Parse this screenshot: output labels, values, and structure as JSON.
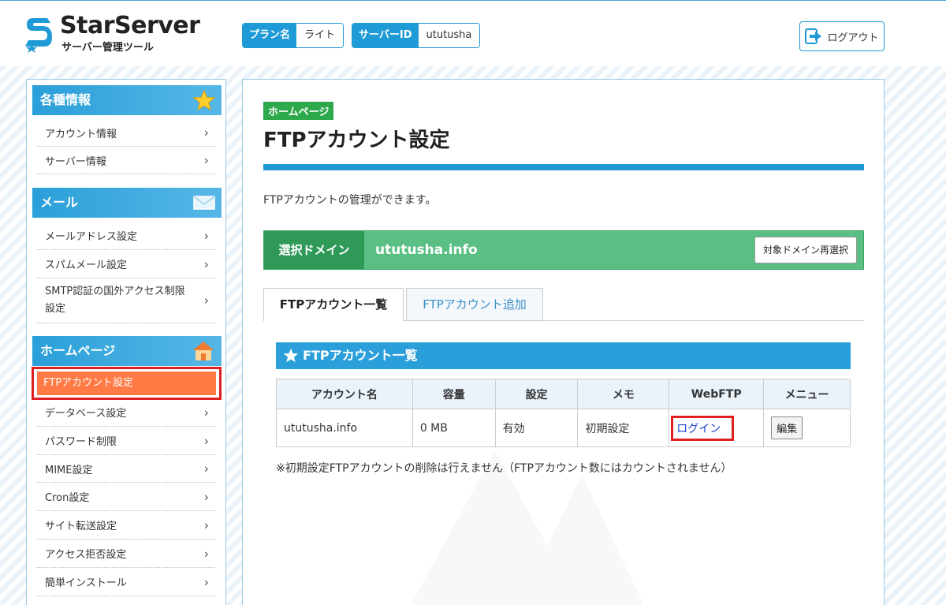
{
  "header": {
    "logo_title": "StarServer",
    "logo_subtitle": "サーバー管理ツール",
    "plan_label": "プラン名",
    "plan_value": "ライト",
    "server_id_label": "サーバーID",
    "server_id_value": "ututusha",
    "logout_label": "ログアウト"
  },
  "sidebar": {
    "sections": [
      {
        "title": "各種情報",
        "icon": "star-icon",
        "items": [
          "アカウント情報",
          "サーバー情報"
        ]
      },
      {
        "title": "メール",
        "icon": "mail-icon",
        "items": [
          "メールアドレス設定",
          "スパムメール設定",
          "SMTP認証の国外アクセス制限設定"
        ]
      },
      {
        "title": "ホームページ",
        "icon": "house-icon",
        "items": [
          "FTPアカウント設定",
          "データベース設定",
          "パスワード制限",
          "MIME設定",
          "Cron設定",
          "サイト転送設定",
          "アクセス拒否設定",
          "簡単インストール"
        ]
      }
    ],
    "smtp_line1": "SMTP認証の国外アクセス制限",
    "smtp_line2": "設定",
    "active_item": "FTPアカウント設定"
  },
  "main": {
    "breadcrumb": "ホームページ",
    "title": "FTPアカウント設定",
    "description": "FTPアカウントの管理ができます。",
    "domain_label": "選択ドメイン",
    "domain_value": "ututusha.info",
    "domain_button": "対象ドメイン再選択",
    "tabs": [
      "FTPアカウント一覧",
      "FTPアカウント追加"
    ],
    "list_title": "FTPアカウント一覧",
    "table": {
      "headers": [
        "アカウント名",
        "容量",
        "設定",
        "メモ",
        "WebFTP",
        "メニュー"
      ],
      "rows": [
        {
          "account": "ututusha.info",
          "capacity": "0 MB",
          "setting": "有効",
          "memo": "初期設定",
          "webftp": "ログイン",
          "menu": "編集"
        }
      ]
    },
    "note": "※初期設定FTPアカウントの削除は行えません（FTPアカウント数にはカウントされません）"
  }
}
